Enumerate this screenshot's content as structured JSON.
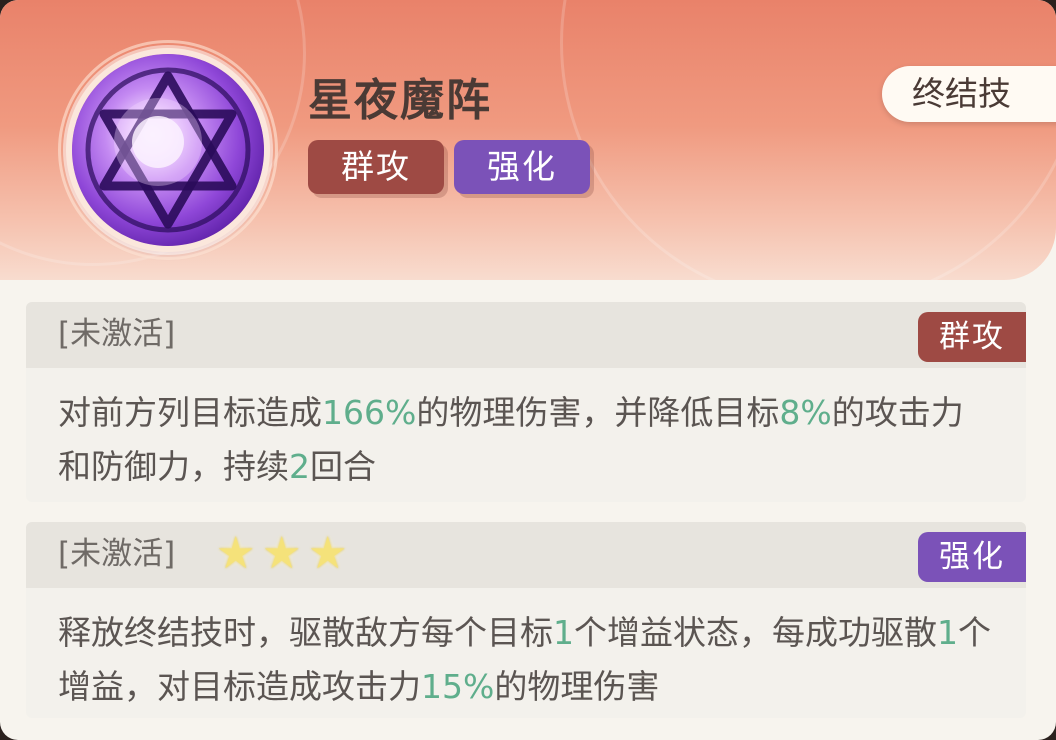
{
  "skill": {
    "name": "星夜魔阵",
    "icon": "hexagram-orb-icon",
    "tags": [
      "群攻",
      "强化"
    ],
    "type_badge": "终结技"
  },
  "effects": [
    {
      "status": "[未激活]",
      "stars": 0,
      "tag": "群攻",
      "text_segments": [
        {
          "t": "对前方列目标造成",
          "hl": false
        },
        {
          "t": "166%",
          "hl": true
        },
        {
          "t": "的物理伤害，并降低目标",
          "hl": false
        },
        {
          "t": "8%",
          "hl": true
        },
        {
          "t": "的攻击力和防御力，持续",
          "hl": false
        },
        {
          "t": "2",
          "hl": true
        },
        {
          "t": "回合",
          "hl": false
        }
      ]
    },
    {
      "status": "[未激活]",
      "stars": 3,
      "tag": "强化",
      "text_segments": [
        {
          "t": "释放终结技时，驱散敌方每个目标",
          "hl": false
        },
        {
          "t": "1",
          "hl": true
        },
        {
          "t": "个增益状态，每成功驱散",
          "hl": false
        },
        {
          "t": "1",
          "hl": true
        },
        {
          "t": "个增益，对目标造成攻击力",
          "hl": false
        },
        {
          "t": "15%",
          "hl": true
        },
        {
          "t": "的物理伤害",
          "hl": false
        }
      ]
    }
  ],
  "colors": {
    "tag_red": "#9e4a44",
    "tag_purple": "#7b52b8",
    "highlight": "#5fae8c"
  }
}
